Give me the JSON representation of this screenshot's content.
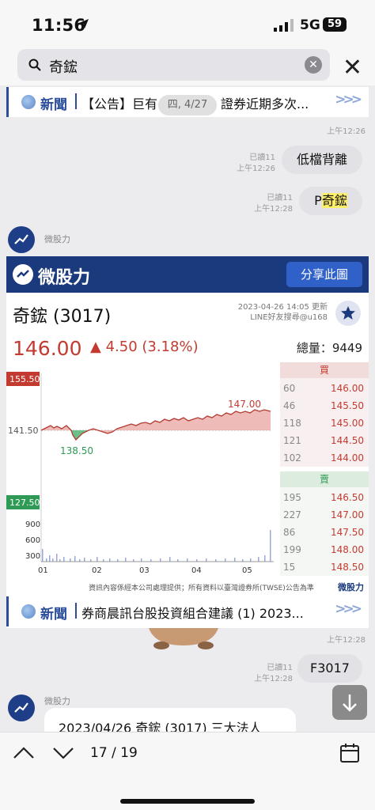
{
  "status": {
    "time": "11:56",
    "network": "5G",
    "battery": "59"
  },
  "search": {
    "query": "奇鋐"
  },
  "news_top": {
    "label": "新聞",
    "text": "【公告】巨有",
    "text2": "證券近期多次...",
    "arrows": ">>>"
  },
  "date_pill": "四, 4/27",
  "times": {
    "t1": "上午12:26",
    "t_read1_a": "已讀11",
    "t_read1_b": "上午12:26",
    "t_read2_a": "已讀11",
    "t_read2_b": "上午12:28",
    "t3": "上午12:28",
    "t_read3_a": "已讀11",
    "t_read3_b": "上午12:28"
  },
  "bubbles": {
    "b1": "低檔背離",
    "b2_prefix": "P",
    "b2_hl": "奇鋐",
    "b3": "F3017"
  },
  "sender": "微股力",
  "card": {
    "brand": "微股力",
    "share": "分享此圖",
    "stock": "奇鋐 (3017)",
    "updated": "2023-04-26 14:05 更新",
    "line_id": "LINE好友搜尋@u168",
    "price": "146.00",
    "change": "▲ 4.50 (3.18%)",
    "volume": "總量：9449",
    "chart_labels": {
      "high": "155.50",
      "low": "127.50",
      "ref": "141.50",
      "max": "147.00",
      "min": "138.50",
      "v900": "900",
      "v600": "600",
      "v300": "300",
      "x01": "01",
      "x02": "02",
      "x03": "03",
      "x04": "04",
      "x05": "05"
    },
    "buy_label": "買",
    "sell_label": "賣",
    "buy": [
      {
        "q": "60",
        "p": "146.00"
      },
      {
        "q": "46",
        "p": "145.50"
      },
      {
        "q": "118",
        "p": "145.00"
      },
      {
        "q": "121",
        "p": "144.50"
      },
      {
        "q": "102",
        "p": "144.00"
      }
    ],
    "sell": [
      {
        "q": "195",
        "p": "146.50"
      },
      {
        "q": "227",
        "p": "147.00"
      },
      {
        "q": "86",
        "p": "147.50"
      },
      {
        "q": "199",
        "p": "148.00"
      },
      {
        "q": "15",
        "p": "148.50"
      }
    ],
    "footnote": "資訊內容係經本公司處理提供；所有資料以臺灣證券所(TWSE)公告為準",
    "footbrand": "微股力"
  },
  "news_bottom": {
    "label": "新聞",
    "text": "券商晨訊台股投資組合建議 (1) 2023...",
    "arrows": ">>>"
  },
  "msg_preview": "2023/04/26 奇鋐 (3017) 三大法人",
  "toolbar": {
    "count": "17 / 19"
  }
}
